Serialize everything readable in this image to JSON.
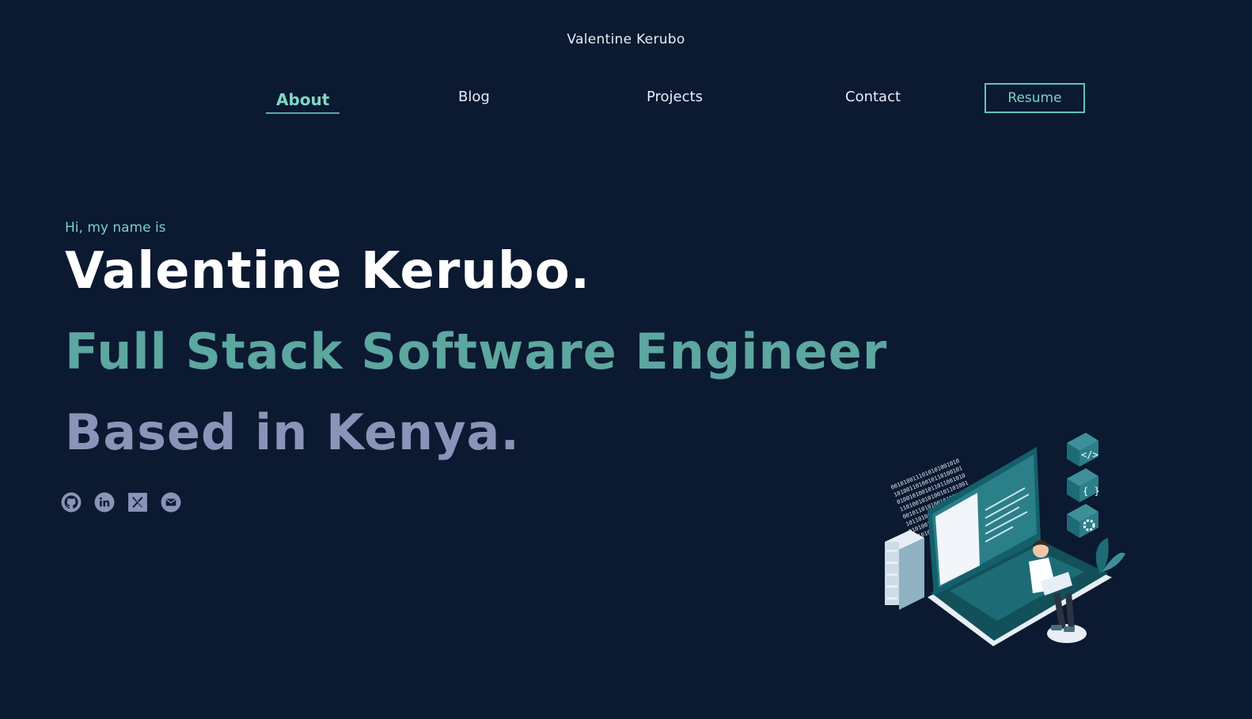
{
  "header": {
    "site_title": "Valentine Kerubo"
  },
  "nav": {
    "items": [
      {
        "label": "About",
        "active": true
      },
      {
        "label": "Blog",
        "active": false
      },
      {
        "label": "Projects",
        "active": false
      },
      {
        "label": "Contact",
        "active": false
      }
    ],
    "resume_label": "Resume"
  },
  "hero": {
    "greeting": "Hi, my name is",
    "name": "Valentine Kerubo.",
    "role": "Full Stack Software Engineer",
    "location": "Based in Kenya."
  },
  "socials": [
    {
      "icon": "github-icon"
    },
    {
      "icon": "linkedin-icon"
    },
    {
      "icon": "x-twitter-icon"
    },
    {
      "icon": "email-icon"
    }
  ],
  "colors": {
    "background": "#0b1931",
    "accent": "#79d3c3",
    "role_text": "#5ca7a0",
    "location_text": "#8a93b8",
    "icon_fill": "#8a93b8"
  },
  "illustration": {
    "subject": "isometric-developer-laptop-illustration"
  }
}
